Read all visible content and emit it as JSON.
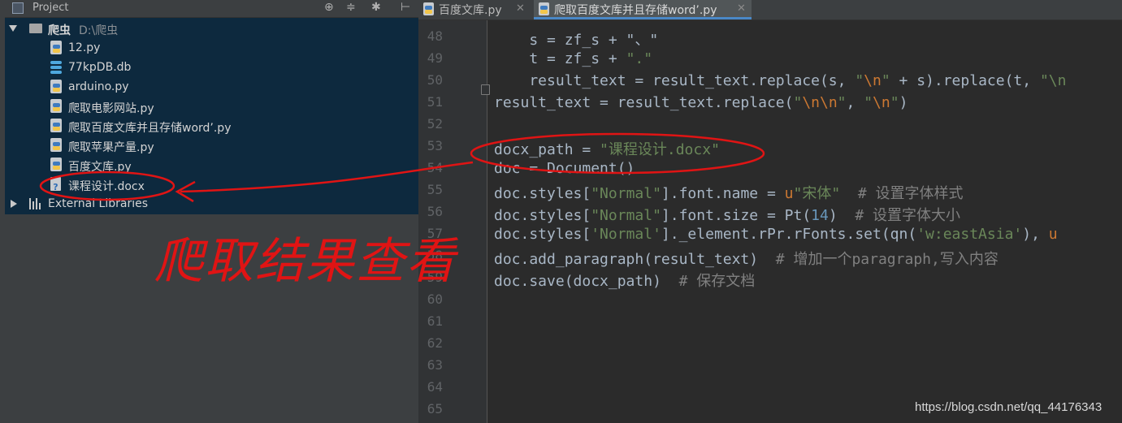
{
  "project_panel": {
    "title": "Project",
    "tools": [
      "⊕",
      "≑",
      "✱",
      "⊢"
    ],
    "tree": [
      {
        "label": "爬虫",
        "extra": "D:\\爬虫",
        "kind": "folder",
        "expanded": true
      },
      {
        "label": "12.py",
        "kind": "py"
      },
      {
        "label": "77kpDB.db",
        "kind": "db"
      },
      {
        "label": "arduino.py",
        "kind": "py"
      },
      {
        "label": "爬取电影网站.py",
        "kind": "py"
      },
      {
        "label": "爬取百度文库并且存储word’.py",
        "kind": "py"
      },
      {
        "label": "爬取苹果产量.py",
        "kind": "py"
      },
      {
        "label": "百度文库.py",
        "kind": "py"
      },
      {
        "label": "课程设计.docx",
        "kind": "docx"
      },
      {
        "label": "External Libraries",
        "kind": "lib",
        "expanded": false
      }
    ]
  },
  "editor": {
    "tabs": [
      {
        "label": "百度文库.py",
        "active": false
      },
      {
        "label": "爬取百度文库并且存储word’.py",
        "active": true
      }
    ],
    "line_numbers": [
      "48",
      "49",
      "50",
      "51",
      "52",
      "53",
      "54",
      "55",
      "56",
      "57",
      "58",
      "59",
      "60",
      "61",
      "62",
      "63",
      "64",
      "65"
    ],
    "lines": [
      [
        {
          "t": "    s = zf_s + \"、\""
        }
      ],
      [
        {
          "t": "    t = zf_s + "
        },
        {
          "t": "\".\"",
          "c": "str"
        }
      ],
      [
        {
          "t": "    result_text = result_text.replace(s, "
        },
        {
          "t": "\"",
          "c": "str"
        },
        {
          "t": "\\n",
          "c": "esc"
        },
        {
          "t": "\"",
          "c": "str"
        },
        {
          "t": " + s).replace(t, "
        },
        {
          "t": "\"\\n",
          "c": "str"
        }
      ],
      [
        {
          "t": "result_text = result_text.replace("
        },
        {
          "t": "\"",
          "c": "str"
        },
        {
          "t": "\\n\\n",
          "c": "esc"
        },
        {
          "t": "\"",
          "c": "str"
        },
        {
          "t": ", "
        },
        {
          "t": "\"",
          "c": "str"
        },
        {
          "t": "\\n",
          "c": "esc"
        },
        {
          "t": "\"",
          "c": "str"
        },
        {
          "t": ")"
        }
      ],
      [],
      [
        {
          "t": "docx_path = "
        },
        {
          "t": "\"课程设计.docx\"",
          "c": "str"
        }
      ],
      [
        {
          "t": "doc = Document()"
        }
      ],
      [
        {
          "t": "doc.styles["
        },
        {
          "t": "\"Normal\"",
          "c": "str"
        },
        {
          "t": "].font.name = "
        },
        {
          "t": "u",
          "c": "u"
        },
        {
          "t": "\"宋体\"",
          "c": "str"
        },
        {
          "t": "  "
        },
        {
          "t": "# 设置字体样式",
          "c": "cmt"
        }
      ],
      [
        {
          "t": "doc.styles["
        },
        {
          "t": "\"Normal\"",
          "c": "str"
        },
        {
          "t": "].font.size = Pt("
        },
        {
          "t": "14",
          "c": "num"
        },
        {
          "t": ")  "
        },
        {
          "t": "# 设置字体大小",
          "c": "cmt"
        }
      ],
      [
        {
          "t": "doc.styles["
        },
        {
          "t": "'Normal'",
          "c": "str"
        },
        {
          "t": "]._element.rPr.rFonts.set(qn("
        },
        {
          "t": "'w:eastAsia'",
          "c": "str"
        },
        {
          "t": "), "
        },
        {
          "t": "u",
          "c": "u"
        }
      ],
      [
        {
          "t": "doc.add_paragraph(result_text)  "
        },
        {
          "t": "# 增加一个paragraph,写入内容",
          "c": "cmt"
        }
      ],
      [
        {
          "t": "doc.save(docx_path)  "
        },
        {
          "t": "# 保存文档",
          "c": "cmt"
        }
      ],
      [],
      [],
      [],
      [],
      [],
      []
    ]
  },
  "annotation": {
    "text": "爬取结果查看",
    "color": "#e01414"
  },
  "watermark": "https://blog.csdn.net/qq_44176343"
}
